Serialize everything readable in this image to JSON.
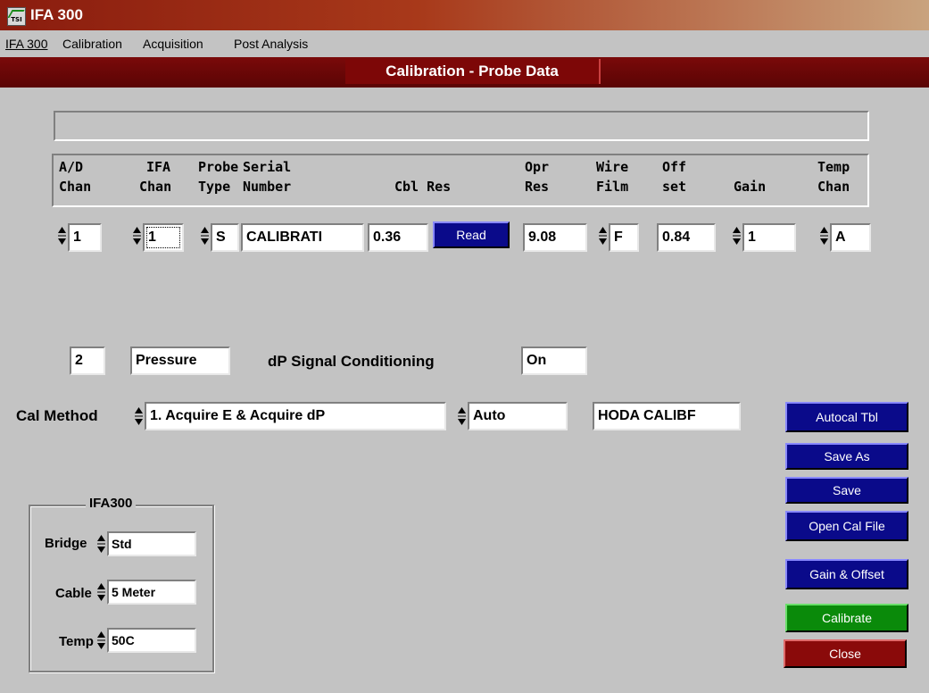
{
  "window": {
    "title": "IFA 300",
    "logo_text": "TSI"
  },
  "menu": [
    "IFA 300",
    "Calibration",
    "Acquisition",
    "Post Analysis"
  ],
  "panel_title": "Calibration - Probe Data",
  "headers": {
    "ad_chan": [
      "A/D",
      "Chan"
    ],
    "ifa_chan": [
      "IFA",
      "Chan"
    ],
    "probe_type": [
      "Probe",
      "Type"
    ],
    "serial": [
      "Serial",
      "Number"
    ],
    "cbl_res": "Cbl Res",
    "opr_res": [
      "Opr",
      "Res"
    ],
    "wire_film": [
      "Wire",
      "Film"
    ],
    "offset": [
      "Off",
      "set"
    ],
    "gain": "Gain",
    "temp_chan": [
      "Temp",
      "Chan"
    ]
  },
  "row": {
    "ad_chan": "1",
    "ifa_chan": "1",
    "probe_type": "S",
    "serial": "CALIBRATI",
    "cbl_res": "0.36",
    "read_label": "Read",
    "opr_res": "9.08",
    "wire_film": "F",
    "offset": "0.84",
    "gain": "1",
    "temp_chan": "A"
  },
  "pressure": {
    "channel": "2",
    "type": "Pressure",
    "label": "dP Signal Conditioning",
    "state": "On"
  },
  "cal_method": {
    "label": "Cal Method",
    "method": "1. Acquire E & Acquire dP",
    "mode": "Auto",
    "name": "HODA CALIBF"
  },
  "ifa300": {
    "title": "IFA300",
    "bridge_label": "Bridge",
    "bridge": "Std",
    "cable_label": "Cable",
    "cable": "5 Meter",
    "temp_label": "Temp",
    "temp": "50C"
  },
  "buttons": {
    "autocal": "Autocal Tbl",
    "save_as": "Save As",
    "save": "Save",
    "open_cal": "Open Cal File",
    "gain_offset": "Gain & Offset",
    "calibrate": "Calibrate",
    "close": "Close"
  },
  "colors": {
    "title_red": "#8a1c0e",
    "button_blue": "#0a0a8a",
    "button_green": "#0a8a0a",
    "button_red": "#8a0a0a",
    "background": "#c3c3c3"
  }
}
